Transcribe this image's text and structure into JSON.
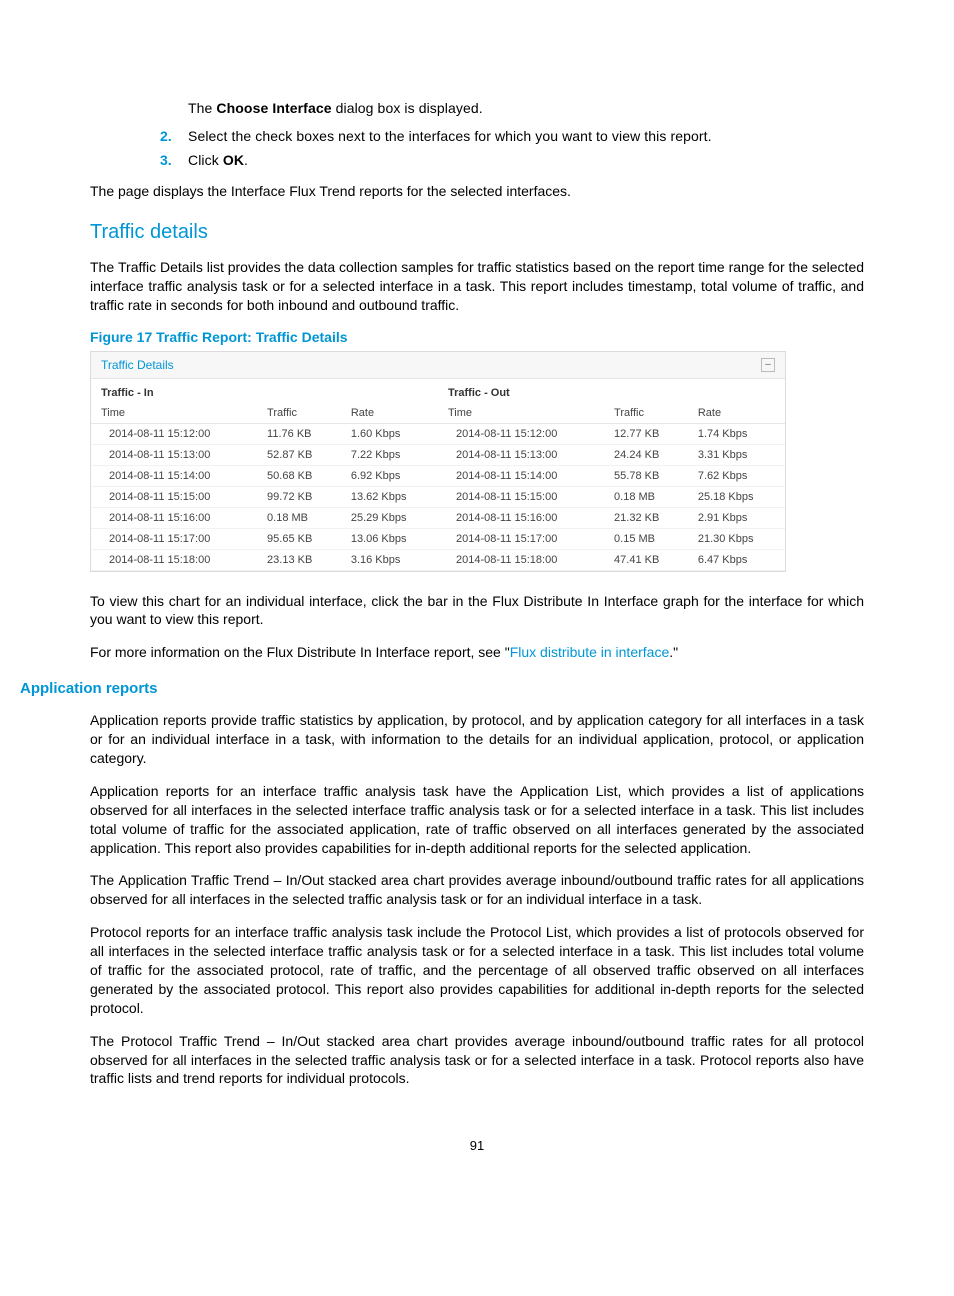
{
  "ordered": {
    "pre": "The <b>Choose Interface</b> dialog box is displayed.",
    "two_num": "2.",
    "two_body": "Select the check boxes next to the interfaces for which you want to view this report.",
    "three_num": "3.",
    "three_body": "Click <b>OK</b>."
  },
  "p_after_ol": "The page displays the <b>Interface Flux Trend</b> reports for the selected interfaces.",
  "h_traffic_details": "Traffic details",
  "p_traffic_details": "The <b>Traffic Details</b> list provides the data collection samples for traffic statistics based on the report time range for the selected interface traffic analysis task or for a selected interface in a task. This report includes timestamp, total volume of traffic, and traffic rate in seconds for both inbound and outbound traffic.",
  "fig_caption": "Figure 17 Traffic Report: Traffic Details",
  "shot": {
    "title": "Traffic Details",
    "collapse_glyph": "–",
    "in_label": "Traffic - In",
    "out_label": "Traffic - Out",
    "cols": {
      "time": "Time",
      "traffic": "Traffic",
      "rate": "Rate"
    }
  },
  "chart_data": {
    "type": "table",
    "title": "Traffic Details",
    "columns": [
      "Time",
      "Traffic - In (Traffic)",
      "Traffic - In (Rate)",
      "Traffic - Out (Traffic)",
      "Traffic - Out (Rate)"
    ],
    "in_rows": [
      {
        "time": "2014-08-11 15:12:00",
        "traffic": "11.76 KB",
        "rate": "1.60 Kbps"
      },
      {
        "time": "2014-08-11 15:13:00",
        "traffic": "52.87 KB",
        "rate": "7.22 Kbps"
      },
      {
        "time": "2014-08-11 15:14:00",
        "traffic": "50.68 KB",
        "rate": "6.92 Kbps"
      },
      {
        "time": "2014-08-11 15:15:00",
        "traffic": "99.72 KB",
        "rate": "13.62 Kbps"
      },
      {
        "time": "2014-08-11 15:16:00",
        "traffic": "0.18 MB",
        "rate": "25.29 Kbps"
      },
      {
        "time": "2014-08-11 15:17:00",
        "traffic": "95.65 KB",
        "rate": "13.06 Kbps"
      },
      {
        "time": "2014-08-11 15:18:00",
        "traffic": "23.13 KB",
        "rate": "3.16 Kbps"
      }
    ],
    "out_rows": [
      {
        "time": "2014-08-11 15:12:00",
        "traffic": "12.77 KB",
        "rate": "1.74 Kbps"
      },
      {
        "time": "2014-08-11 15:13:00",
        "traffic": "24.24 KB",
        "rate": "3.31 Kbps"
      },
      {
        "time": "2014-08-11 15:14:00",
        "traffic": "55.78 KB",
        "rate": "7.62 Kbps"
      },
      {
        "time": "2014-08-11 15:15:00",
        "traffic": "0.18 MB",
        "rate": "25.18 Kbps"
      },
      {
        "time": "2014-08-11 15:16:00",
        "traffic": "21.32 KB",
        "rate": "2.91 Kbps"
      },
      {
        "time": "2014-08-11 15:17:00",
        "traffic": "0.15 MB",
        "rate": "21.30 Kbps"
      },
      {
        "time": "2014-08-11 15:18:00",
        "traffic": "47.41 KB",
        "rate": "6.47 Kbps"
      }
    ]
  },
  "p_view_chart": "To view this chart for an individual interface, click the bar in the <b>Flux Distribute In Interface</b> graph for the interface for which you want to view this report.",
  "p_more_info_pre": "For more information on the Flux Distribute In Interface report, see \"",
  "p_more_info_link": "Flux distribute in interface",
  "p_more_info_post": ".\"",
  "h_app_reports": "Application reports",
  "p_app_1": "Application reports provide traffic statistics by application, by protocol, and by application category for all interfaces in a task or for an individual interface in a task, with information to the details for an individual application, protocol, or application category.",
  "p_app_2": "Application reports for an interface traffic analysis task have the <b>Application List</b>, which provides a list of applications observed for all interfaces in the selected interface traffic analysis task or for a selected interface in a task. This list includes total volume of traffic for the associated application, rate of traffic observed on all interfaces generated by the associated application. This report also provides capabilities for in-depth additional reports for the selected application.",
  "p_app_3": "The <b>Application Traffic Trend – In/Out</b> stacked area chart provides average inbound/outbound traffic rates for all applications observed for all interfaces in the selected traffic analysis task or for an individual interface in a task.",
  "p_app_4": "Protocol reports for an interface traffic analysis task include the <b>Protocol List</b>, which provides a list of protocols observed for all interfaces in the selected interface traffic analysis task or for a selected interface in a task. This list includes total volume of traffic for the associated protocol, rate of traffic, and the percentage of all observed traffic observed on all interfaces generated by the associated protocol. This report also provides capabilities for additional in-depth reports for the selected protocol.",
  "p_app_5": "The <b>Protocol Traffic Trend – In/Out</b> stacked area chart provides average inbound/outbound traffic rates for all protocol observed for all interfaces in the selected traffic analysis task or for a selected interface in a task. Protocol reports also have traffic lists and trend reports for individual protocols.",
  "page_number": "91"
}
